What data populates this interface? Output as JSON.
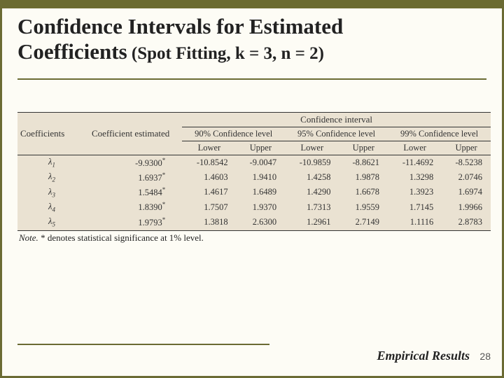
{
  "title_line1": "Confidence Intervals for Estimated",
  "title_line2a": "Coefficients",
  "title_line2b": " (Spot Fitting, k = 3, n = 2)",
  "table": {
    "header_ci": "Confidence interval",
    "header_coefficients": "Coefficients",
    "header_est": "Coefficient estimated",
    "levels": [
      "90% Confidence level",
      "95% Confidence level",
      "99% Confidence level"
    ],
    "lower": "Lower",
    "upper": "Upper",
    "rows": [
      {
        "name": "λ",
        "sub": "1",
        "est": "-9.9300",
        "star": "*",
        "l90": "-10.8542",
        "u90": "-9.0047",
        "l95": "-10.9859",
        "u95": "-8.8621",
        "l99": "-11.4692",
        "u99": "-8.5238"
      },
      {
        "name": "λ",
        "sub": "2",
        "est": "1.6937",
        "star": "*",
        "l90": "1.4603",
        "u90": "1.9410",
        "l95": "1.4258",
        "u95": "1.9878",
        "l99": "1.3298",
        "u99": "2.0746"
      },
      {
        "name": "λ",
        "sub": "3",
        "est": "1.5484",
        "star": "*",
        "l90": "1.4617",
        "u90": "1.6489",
        "l95": "1.4290",
        "u95": "1.6678",
        "l99": "1.3923",
        "u99": "1.6974"
      },
      {
        "name": "λ",
        "sub": "4",
        "est": "1.8390",
        "star": "*",
        "l90": "1.7507",
        "u90": "1.9370",
        "l95": "1.7313",
        "u95": "1.9559",
        "l99": "1.7145",
        "u99": "1.9966"
      },
      {
        "name": "λ",
        "sub": "5",
        "est": "1.9793",
        "star": "*",
        "l90": "1.3818",
        "u90": "2.6300",
        "l95": "1.2961",
        "u95": "2.7149",
        "l99": "1.1116",
        "u99": "2.8783"
      }
    ]
  },
  "note_label": "Note.",
  "note_text": " * denotes statistical significance at 1% level.",
  "footer": "Empirical Results",
  "page": "28",
  "chart_data": {
    "type": "table",
    "title": "Confidence Intervals for Estimated Coefficients (Spot Fitting, k = 3, n = 2)",
    "columns": [
      "Coefficient",
      "Estimate",
      "90% Lower",
      "90% Upper",
      "95% Lower",
      "95% Upper",
      "99% Lower",
      "99% Upper"
    ],
    "rows": [
      [
        "λ1",
        -9.93,
        -10.8542,
        -9.0047,
        -10.9859,
        -8.8621,
        -11.4692,
        -8.5238
      ],
      [
        "λ2",
        1.6937,
        1.4603,
        1.941,
        1.4258,
        1.9878,
        1.3298,
        2.0746
      ],
      [
        "λ3",
        1.5484,
        1.4617,
        1.6489,
        1.429,
        1.6678,
        1.3923,
        1.6974
      ],
      [
        "λ4",
        1.839,
        1.7507,
        1.937,
        1.7313,
        1.9559,
        1.7145,
        1.9966
      ],
      [
        "λ5",
        1.9793,
        1.3818,
        2.63,
        1.2961,
        2.7149,
        1.1116,
        2.8783
      ]
    ],
    "note": "* denotes statistical significance at 1% level."
  }
}
